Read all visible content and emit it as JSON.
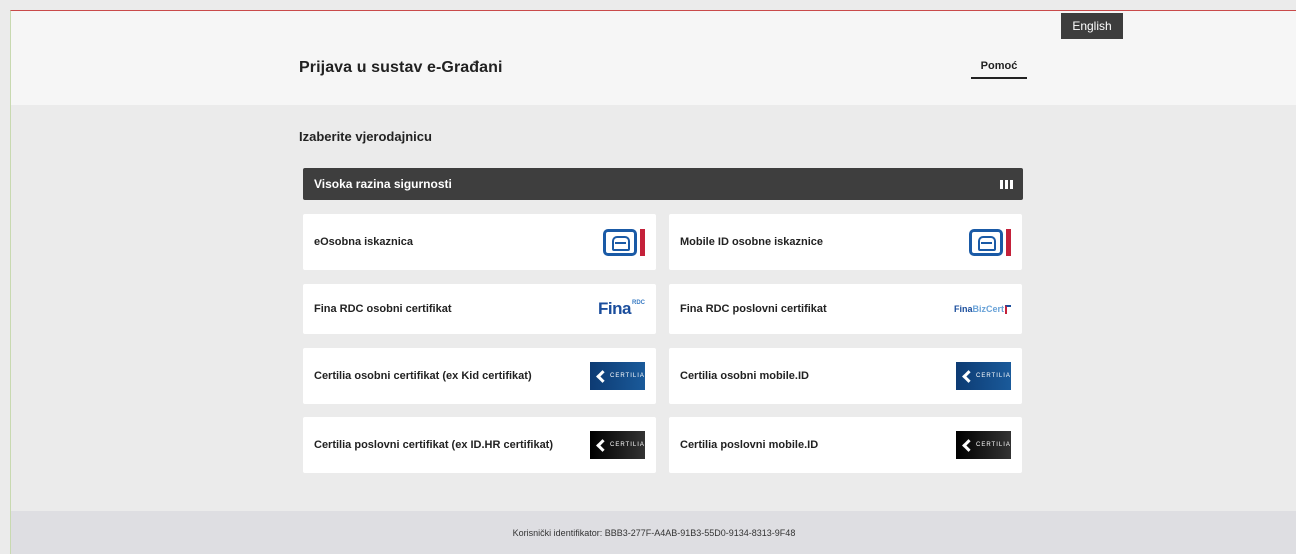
{
  "header": {
    "language_button": "English",
    "title": "Prijava u sustav e-Građani",
    "help_link": "Pomoć"
  },
  "main": {
    "section_title": "Izaberite vjerodajnicu",
    "level": {
      "label": "Visoka razina sigurnosti",
      "icon": "security-level-bars-icon"
    },
    "credentials": [
      {
        "label": "eOsobna iskaznica",
        "logo": "eoi-logo"
      },
      {
        "label": "Mobile ID osobne iskaznice",
        "logo": "eoi-logo"
      },
      {
        "label": "Fina RDC osobni certifikat",
        "logo": "fina-rdc-logo",
        "logo_text": "Fina",
        "logo_sup": "RDC"
      },
      {
        "label": "Fina RDC poslovni certifikat",
        "logo": "fina-bizcert-logo",
        "logo_text": "Fina",
        "logo_biz": "BizCert"
      },
      {
        "label": "Certilia osobni certifikat (ex Kid certifikat)",
        "logo": "certilia-blue-logo"
      },
      {
        "label": "Certilia osobni mobile.ID",
        "logo": "certilia-blue-logo"
      },
      {
        "label": "Certilia poslovni certifikat (ex ID.HR certifikat)",
        "logo": "certilia-black-logo"
      },
      {
        "label": "Certilia poslovni mobile.ID",
        "logo": "certilia-black-logo"
      }
    ],
    "certilia_text": "CERTILIA"
  },
  "footer": {
    "user_id_text": "Korisnički identifikator: BBB3-277F-A4AB-91B3-55D0-9134-8313-9F48"
  },
  "colors": {
    "dark_bar": "#3e3e3e",
    "eoi_blue": "#1a5aa6",
    "eoi_red": "#c4213a",
    "fina_blue": "#1a4d9c"
  }
}
